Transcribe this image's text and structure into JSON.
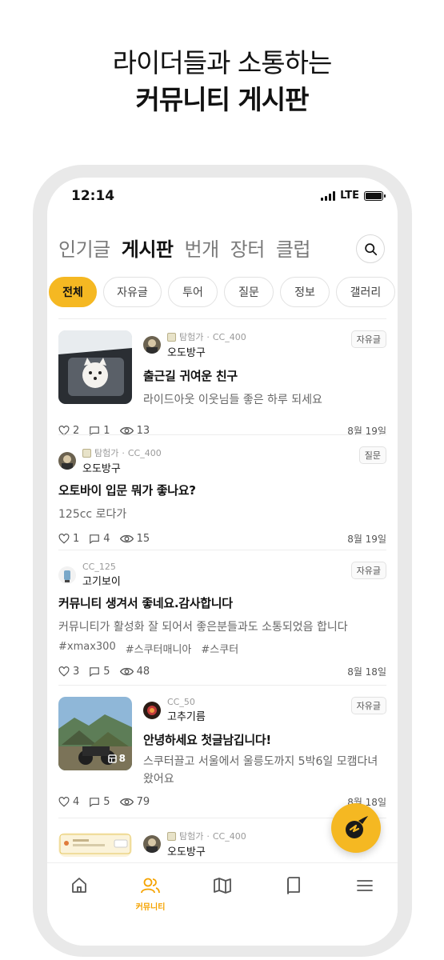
{
  "headline": {
    "line1": "라이더들과 소통하는",
    "line2": "커뮤니티 게시판"
  },
  "status_bar": {
    "time": "12:14",
    "network": "LTE"
  },
  "top_tabs": [
    {
      "label": "인기글",
      "active": false
    },
    {
      "label": "게시판",
      "active": true
    },
    {
      "label": "번개",
      "active": false
    },
    {
      "label": "장터",
      "active": false
    },
    {
      "label": "클럽",
      "active": false
    }
  ],
  "chips": [
    {
      "label": "전체",
      "active": true
    },
    {
      "label": "자유글",
      "active": false
    },
    {
      "label": "투어",
      "active": false
    },
    {
      "label": "질문",
      "active": false
    },
    {
      "label": "정보",
      "active": false
    },
    {
      "label": "갤러리",
      "active": false
    }
  ],
  "posts": [
    {
      "level": "탐험가",
      "cc": "CC_400",
      "author": "오도방구",
      "tag": "자유글",
      "title": "출근길 귀여운 친구",
      "body": "라이드아웃 이웃님들 좋은 하루 되세요",
      "likes": "2",
      "comments": "1",
      "views": "13",
      "date": "8월 19일"
    },
    {
      "level": "탐험가",
      "cc": "CC_400",
      "author": "오도방구",
      "tag": "질문",
      "title": "오토바이 입문 뭐가 좋나요?",
      "body": "125cc 로다가",
      "likes": "1",
      "comments": "4",
      "views": "15",
      "date": "8월 19일"
    },
    {
      "cc": "CC_125",
      "author": "고기보이",
      "tag": "자유글",
      "title": "커뮤니티 생겨서 좋네요.감사합니다",
      "body": "커뮤니티가 활성화 잘 되어서 좋은분들과도 소통되었음 합니다",
      "hashtags": [
        "#xmax300",
        "#스쿠터매니아",
        "#스쿠터"
      ],
      "likes": "3",
      "comments": "5",
      "views": "48",
      "date": "8월 18일"
    },
    {
      "cc": "CC_50",
      "author": "고추기름",
      "tag": "자유글",
      "title": "안녕하세요 첫글남깁니다!",
      "body": "스쿠터끌고 서울에서 울릉도까지 5박6일 모캠다녀왔어요",
      "photo_count": "8",
      "likes": "4",
      "comments": "5",
      "views": "79",
      "date": "8월 18일"
    },
    {
      "level": "탐험가",
      "cc": "CC_400",
      "author": "오도방구"
    }
  ],
  "bottom_nav": {
    "active_label": "커뮤니티"
  },
  "colors": {
    "accent": "#f5b822",
    "accent_text": "#f5a300"
  }
}
